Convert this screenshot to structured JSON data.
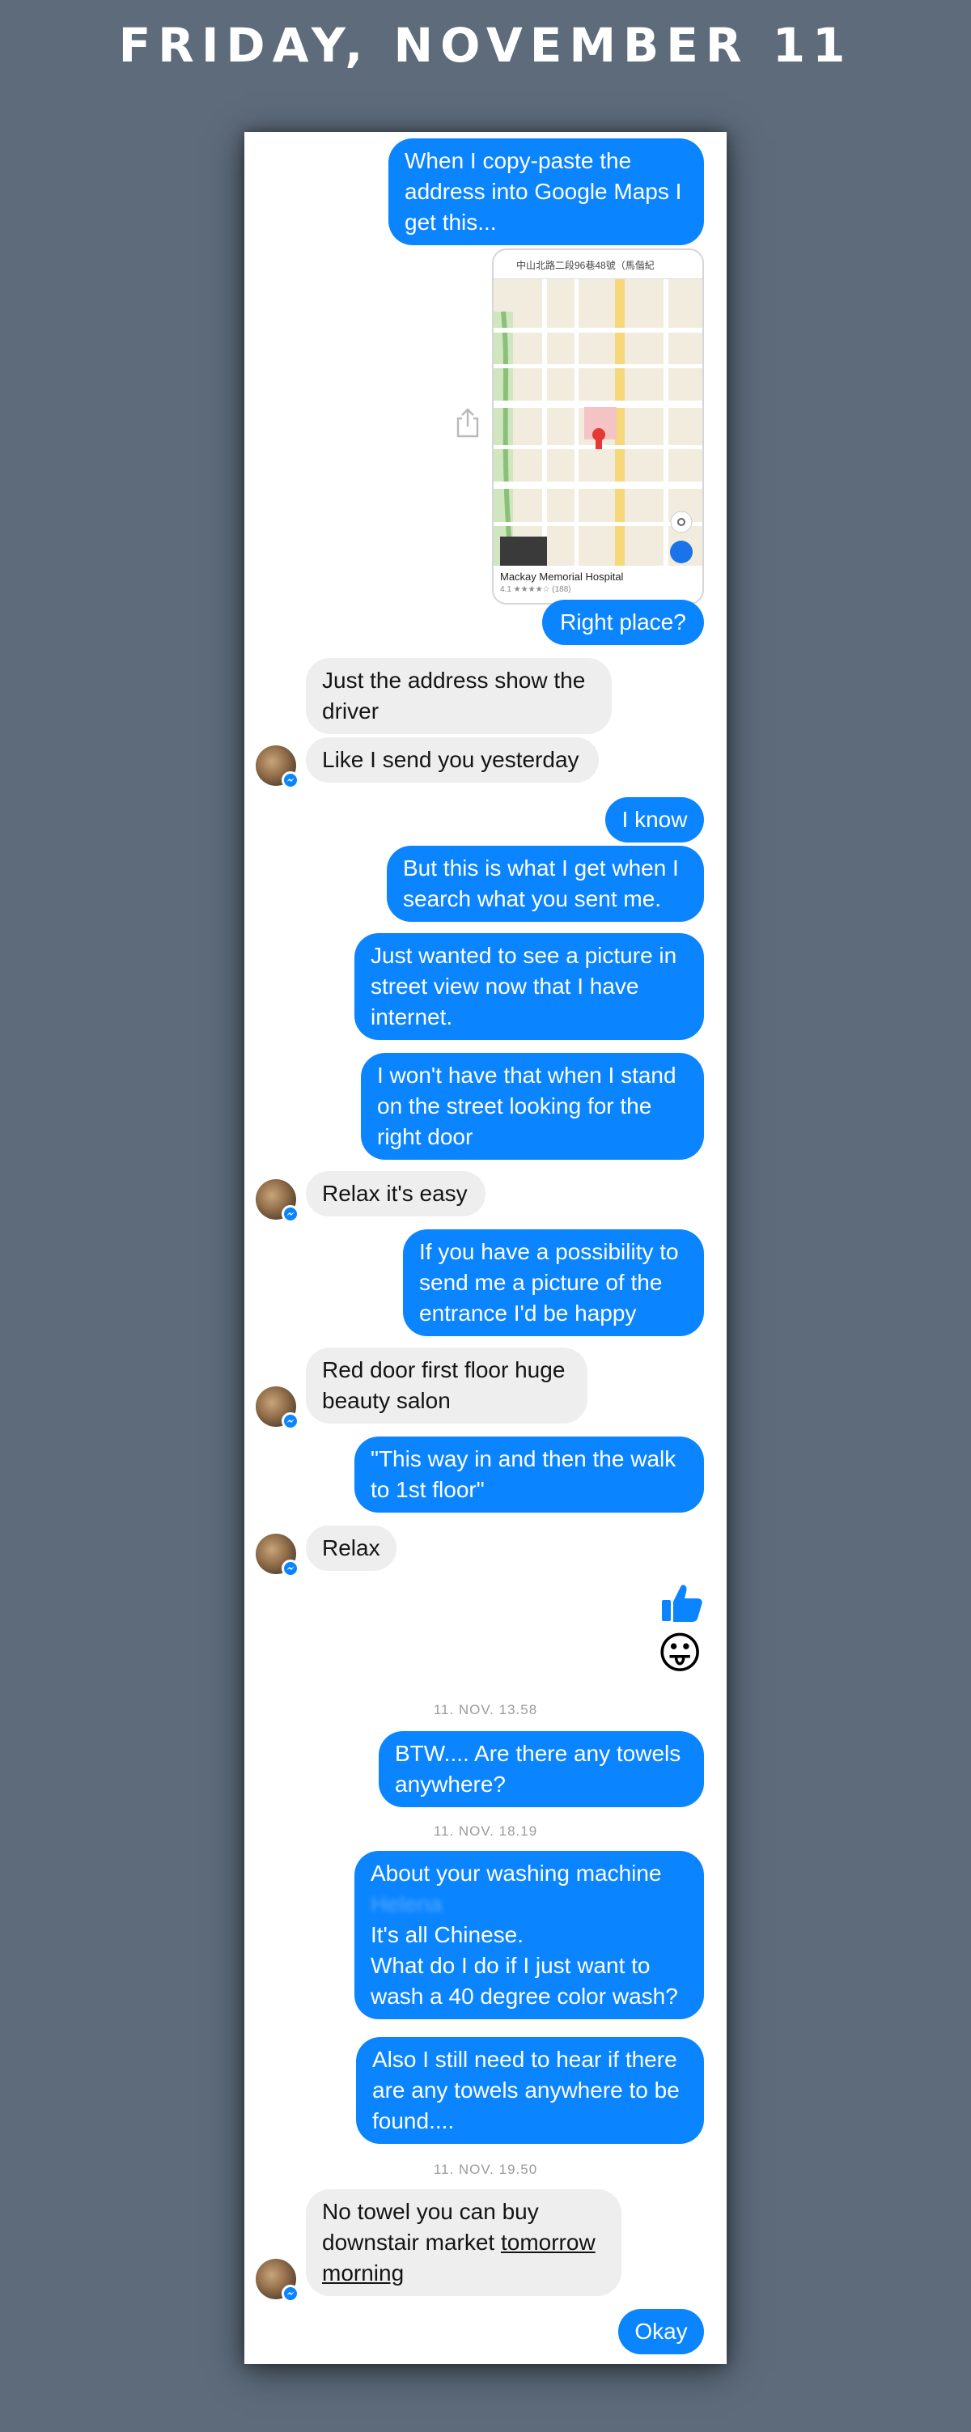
{
  "header": {
    "date_title": "FRIDAY, NOVEMBER 11"
  },
  "map_preview": {
    "search_text": "中山北路二段96巷48號（馬偕紀",
    "place_label": "Mackay Memorial Hospital",
    "rating_text": "4.1 ★★★★☆ (188)"
  },
  "messages": {
    "m1": "When I copy-paste the address into Google Maps I get this...",
    "m2": "Right place?",
    "m3": "Just the address show the driver",
    "m4": "Like I send you yesterday",
    "m5": "I know",
    "m6": "But this is what I get when I search what you sent me.",
    "m7": "Just wanted to see a picture in street view now that I have internet.",
    "m8": "I won't have that when I stand on the street looking for the right door",
    "m9": "Relax it's easy",
    "m10": "If you have a possibility to send me a picture of the entrance I'd be happy",
    "m11": "Red door first floor huge beauty salon",
    "m12": "\"This way in and then the walk to 1st floor\"",
    "m13": "Relax",
    "m14": "BTW.... Are there any towels anywhere?",
    "m15_line1": "About your washing machine",
    "m15_blurred": "Helena",
    "m15_line2": "It's all Chinese.",
    "m15_line3": "What do I do if I just want to wash a 40 degree color wash?",
    "m16": "Also I still need to hear if there are any towels anywhere to be found....",
    "m17_part1": "No towel you can buy downstair market ",
    "m17_link": "tomorrow morning",
    "m18": "Okay"
  },
  "timestamps": {
    "t1": "11. NOV. 13.58",
    "t2": "11. NOV. 18.19",
    "t3": "11. NOV. 19.50"
  },
  "reactions": {
    "emoji": "😛"
  },
  "colors": {
    "background": "#5d6b7b",
    "outgoing_bubble": "#0a84ff",
    "incoming_bubble": "#eeeeef",
    "timestamp_text": "#9b9b9f"
  }
}
